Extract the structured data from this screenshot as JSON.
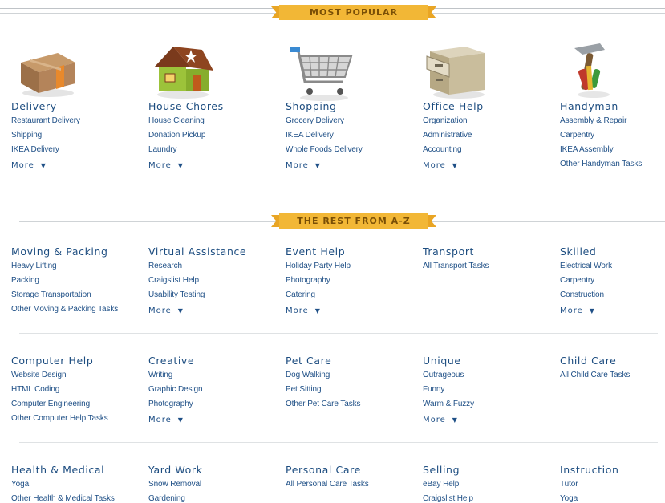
{
  "popular": {
    "banner": "MOST POPULAR",
    "categories": [
      {
        "title": "Delivery",
        "icon": "box-icon",
        "links": [
          "Restaurant Delivery",
          "Shipping",
          "IKEA Delivery"
        ],
        "more": "More"
      },
      {
        "title": "House Chores",
        "icon": "house-icon",
        "links": [
          "House Cleaning",
          "Donation Pickup",
          "Laundry"
        ],
        "more": "More"
      },
      {
        "title": "Shopping",
        "icon": "shopping-cart-icon",
        "links": [
          "Grocery Delivery",
          "IKEA Delivery",
          "Whole Foods Delivery"
        ],
        "more": "More"
      },
      {
        "title": "Office Help",
        "icon": "file-cabinet-icon",
        "links": [
          "Organization",
          "Administrative",
          "Accounting"
        ],
        "more": "More"
      },
      {
        "title": "Handyman",
        "icon": "tools-icon",
        "links": [
          "Assembly & Repair",
          "Carpentry",
          "IKEA Assembly",
          "Other Handyman Tasks"
        ]
      }
    ]
  },
  "rest": {
    "banner": "THE REST FROM A-Z",
    "rows": [
      [
        {
          "title": "Moving & Packing",
          "links": [
            "Heavy Lifting",
            "Packing",
            "Storage Transportation",
            "Other Moving & Packing Tasks"
          ]
        },
        {
          "title": "Virtual Assistance",
          "links": [
            "Research",
            "Craigslist Help",
            "Usability Testing"
          ],
          "more": "More"
        },
        {
          "title": "Event Help",
          "links": [
            "Holiday Party Help",
            "Photography",
            "Catering"
          ],
          "more": "More"
        },
        {
          "title": "Transport",
          "links": [
            "All Transport Tasks"
          ]
        },
        {
          "title": "Skilled",
          "links": [
            "Electrical Work",
            "Carpentry",
            "Construction"
          ],
          "more": "More"
        }
      ],
      [
        {
          "title": "Computer Help",
          "links": [
            "Website Design",
            "HTML Coding",
            "Computer Engineering",
            "Other Computer Help Tasks"
          ]
        },
        {
          "title": "Creative",
          "links": [
            "Writing",
            "Graphic Design",
            "Photography"
          ],
          "more": "More"
        },
        {
          "title": "Pet Care",
          "links": [
            "Dog Walking",
            "Pet Sitting",
            "Other Pet Care Tasks"
          ]
        },
        {
          "title": "Unique",
          "links": [
            "Outrageous",
            "Funny",
            "Warm & Fuzzy"
          ],
          "more": "More"
        },
        {
          "title": "Child Care",
          "links": [
            "All Child Care Tasks"
          ]
        }
      ],
      [
        {
          "title": "Health & Medical",
          "links": [
            "Yoga",
            "Other Health & Medical Tasks"
          ]
        },
        {
          "title": "Yard Work",
          "links": [
            "Snow Removal",
            "Gardening"
          ]
        },
        {
          "title": "Personal Care",
          "links": [
            "All Personal Care Tasks"
          ]
        },
        {
          "title": "Selling",
          "links": [
            "eBay Help",
            "Craigslist Help"
          ]
        },
        {
          "title": "Instruction",
          "links": [
            "Tutor",
            "Yoga"
          ]
        }
      ]
    ]
  },
  "colors": {
    "banner_fill": "#f2b736",
    "banner_text": "#7a4f06",
    "link": "#1e4f86"
  }
}
